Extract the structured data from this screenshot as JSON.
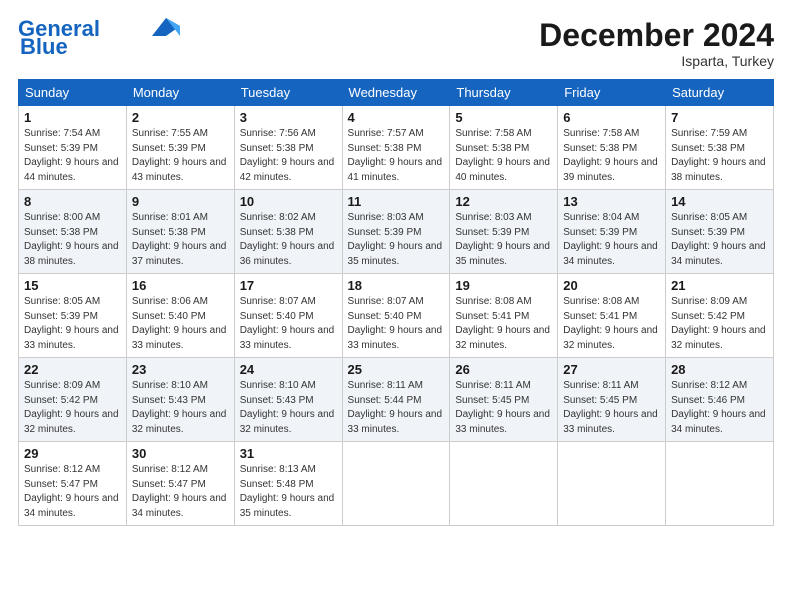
{
  "header": {
    "logo_line1": "General",
    "logo_line2": "Blue",
    "month": "December 2024",
    "location": "Isparta, Turkey"
  },
  "weekdays": [
    "Sunday",
    "Monday",
    "Tuesday",
    "Wednesday",
    "Thursday",
    "Friday",
    "Saturday"
  ],
  "weeks": [
    [
      {
        "day": "1",
        "sunrise": "7:54 AM",
        "sunset": "5:39 PM",
        "daylight": "9 hours and 44 minutes."
      },
      {
        "day": "2",
        "sunrise": "7:55 AM",
        "sunset": "5:39 PM",
        "daylight": "9 hours and 43 minutes."
      },
      {
        "day": "3",
        "sunrise": "7:56 AM",
        "sunset": "5:38 PM",
        "daylight": "9 hours and 42 minutes."
      },
      {
        "day": "4",
        "sunrise": "7:57 AM",
        "sunset": "5:38 PM",
        "daylight": "9 hours and 41 minutes."
      },
      {
        "day": "5",
        "sunrise": "7:58 AM",
        "sunset": "5:38 PM",
        "daylight": "9 hours and 40 minutes."
      },
      {
        "day": "6",
        "sunrise": "7:58 AM",
        "sunset": "5:38 PM",
        "daylight": "9 hours and 39 minutes."
      },
      {
        "day": "7",
        "sunrise": "7:59 AM",
        "sunset": "5:38 PM",
        "daylight": "9 hours and 38 minutes."
      }
    ],
    [
      {
        "day": "8",
        "sunrise": "8:00 AM",
        "sunset": "5:38 PM",
        "daylight": "9 hours and 38 minutes."
      },
      {
        "day": "9",
        "sunrise": "8:01 AM",
        "sunset": "5:38 PM",
        "daylight": "9 hours and 37 minutes."
      },
      {
        "day": "10",
        "sunrise": "8:02 AM",
        "sunset": "5:38 PM",
        "daylight": "9 hours and 36 minutes."
      },
      {
        "day": "11",
        "sunrise": "8:03 AM",
        "sunset": "5:39 PM",
        "daylight": "9 hours and 35 minutes."
      },
      {
        "day": "12",
        "sunrise": "8:03 AM",
        "sunset": "5:39 PM",
        "daylight": "9 hours and 35 minutes."
      },
      {
        "day": "13",
        "sunrise": "8:04 AM",
        "sunset": "5:39 PM",
        "daylight": "9 hours and 34 minutes."
      },
      {
        "day": "14",
        "sunrise": "8:05 AM",
        "sunset": "5:39 PM",
        "daylight": "9 hours and 34 minutes."
      }
    ],
    [
      {
        "day": "15",
        "sunrise": "8:05 AM",
        "sunset": "5:39 PM",
        "daylight": "9 hours and 33 minutes."
      },
      {
        "day": "16",
        "sunrise": "8:06 AM",
        "sunset": "5:40 PM",
        "daylight": "9 hours and 33 minutes."
      },
      {
        "day": "17",
        "sunrise": "8:07 AM",
        "sunset": "5:40 PM",
        "daylight": "9 hours and 33 minutes."
      },
      {
        "day": "18",
        "sunrise": "8:07 AM",
        "sunset": "5:40 PM",
        "daylight": "9 hours and 33 minutes."
      },
      {
        "day": "19",
        "sunrise": "8:08 AM",
        "sunset": "5:41 PM",
        "daylight": "9 hours and 32 minutes."
      },
      {
        "day": "20",
        "sunrise": "8:08 AM",
        "sunset": "5:41 PM",
        "daylight": "9 hours and 32 minutes."
      },
      {
        "day": "21",
        "sunrise": "8:09 AM",
        "sunset": "5:42 PM",
        "daylight": "9 hours and 32 minutes."
      }
    ],
    [
      {
        "day": "22",
        "sunrise": "8:09 AM",
        "sunset": "5:42 PM",
        "daylight": "9 hours and 32 minutes."
      },
      {
        "day": "23",
        "sunrise": "8:10 AM",
        "sunset": "5:43 PM",
        "daylight": "9 hours and 32 minutes."
      },
      {
        "day": "24",
        "sunrise": "8:10 AM",
        "sunset": "5:43 PM",
        "daylight": "9 hours and 32 minutes."
      },
      {
        "day": "25",
        "sunrise": "8:11 AM",
        "sunset": "5:44 PM",
        "daylight": "9 hours and 33 minutes."
      },
      {
        "day": "26",
        "sunrise": "8:11 AM",
        "sunset": "5:45 PM",
        "daylight": "9 hours and 33 minutes."
      },
      {
        "day": "27",
        "sunrise": "8:11 AM",
        "sunset": "5:45 PM",
        "daylight": "9 hours and 33 minutes."
      },
      {
        "day": "28",
        "sunrise": "8:12 AM",
        "sunset": "5:46 PM",
        "daylight": "9 hours and 34 minutes."
      }
    ],
    [
      {
        "day": "29",
        "sunrise": "8:12 AM",
        "sunset": "5:47 PM",
        "daylight": "9 hours and 34 minutes."
      },
      {
        "day": "30",
        "sunrise": "8:12 AM",
        "sunset": "5:47 PM",
        "daylight": "9 hours and 34 minutes."
      },
      {
        "day": "31",
        "sunrise": "8:13 AM",
        "sunset": "5:48 PM",
        "daylight": "9 hours and 35 minutes."
      },
      null,
      null,
      null,
      null
    ]
  ]
}
